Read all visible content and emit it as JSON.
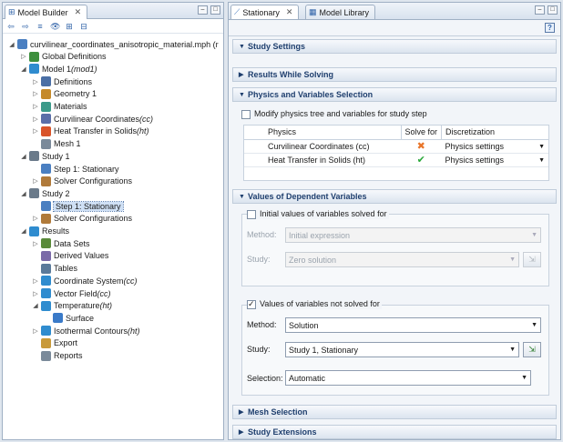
{
  "left_panel": {
    "tab_label": "Model Builder",
    "tree": [
      {
        "label": "curvilinear_coordinates_anisotropic_material.mph (r",
        "italic": "",
        "level": 0,
        "expander": "open",
        "icon": "model-file-icon",
        "color": "#4a7fc1"
      },
      {
        "label": "Global Definitions",
        "italic": "",
        "level": 1,
        "expander": "closed",
        "icon": "global-definitions-icon",
        "color": "#3d8f3d"
      },
      {
        "label": "Model 1 ",
        "italic": "(mod1)",
        "level": 1,
        "expander": "open",
        "icon": "model-icon",
        "color": "#2f8ccf"
      },
      {
        "label": "Definitions",
        "italic": "",
        "level": 2,
        "expander": "closed",
        "icon": "definitions-icon",
        "color": "#4a6fa5"
      },
      {
        "label": "Geometry 1",
        "italic": "",
        "level": 2,
        "expander": "closed",
        "icon": "geometry-icon",
        "color": "#c58a2a"
      },
      {
        "label": "Materials",
        "italic": "",
        "level": 2,
        "expander": "closed",
        "icon": "materials-icon",
        "color": "#3a9a8a"
      },
      {
        "label": "Curvilinear Coordinates ",
        "italic": "(cc)",
        "level": 2,
        "expander": "closed",
        "icon": "curvilinear-coordinates-icon",
        "color": "#5a6ea8"
      },
      {
        "label": "Heat Transfer in Solids ",
        "italic": "(ht)",
        "level": 2,
        "expander": "closed",
        "icon": "heat-transfer-icon",
        "color": "#d9542a"
      },
      {
        "label": "Mesh 1",
        "italic": "",
        "level": 2,
        "expander": "",
        "icon": "mesh-icon",
        "color": "#7a8a9a"
      },
      {
        "label": "Study 1",
        "italic": "",
        "level": 1,
        "expander": "open",
        "icon": "study-icon",
        "color": "#6a7a8a"
      },
      {
        "label": "Step 1: Stationary",
        "italic": "",
        "level": 2,
        "expander": "",
        "icon": "stationary-step-icon",
        "color": "#4a7fc1"
      },
      {
        "label": "Solver Configurations",
        "italic": "",
        "level": 2,
        "expander": "closed",
        "icon": "solver-configurations-icon",
        "color": "#b07a3a"
      },
      {
        "label": "Study 2",
        "italic": "",
        "level": 1,
        "expander": "open",
        "icon": "study-icon",
        "color": "#6a7a8a"
      },
      {
        "label": "Step 1: Stationary",
        "italic": "",
        "level": 2,
        "expander": "",
        "icon": "stationary-step-icon",
        "color": "#4a7fc1",
        "selected": true
      },
      {
        "label": "Solver Configurations",
        "italic": "",
        "level": 2,
        "expander": "closed",
        "icon": "solver-configurations-icon",
        "color": "#b07a3a"
      },
      {
        "label": "Results",
        "italic": "",
        "level": 1,
        "expander": "open",
        "icon": "results-icon",
        "color": "#2f8ccf"
      },
      {
        "label": "Data Sets",
        "italic": "",
        "level": 2,
        "expander": "closed",
        "icon": "data-sets-icon",
        "color": "#5a8a3a"
      },
      {
        "label": "Derived Values",
        "italic": "",
        "level": 2,
        "expander": "",
        "icon": "derived-values-icon",
        "color": "#7a6aa8"
      },
      {
        "label": "Tables",
        "italic": "",
        "level": 2,
        "expander": "",
        "icon": "tables-icon",
        "color": "#5a7a9a"
      },
      {
        "label": "Coordinate System ",
        "italic": "(cc)",
        "level": 2,
        "expander": "closed",
        "icon": "coordinate-system-icon",
        "color": "#2f8ccf"
      },
      {
        "label": "Vector Field ",
        "italic": "(cc)",
        "level": 2,
        "expander": "closed",
        "icon": "vector-field-icon",
        "color": "#2f8ccf"
      },
      {
        "label": "Temperature ",
        "italic": "(ht)",
        "level": 2,
        "expander": "open",
        "icon": "temperature-icon",
        "color": "#2f8ccf"
      },
      {
        "label": "Surface",
        "italic": "",
        "level": 3,
        "expander": "",
        "icon": "surface-icon",
        "color": "#3a7ac8"
      },
      {
        "label": "Isothermal Contours ",
        "italic": "(ht)",
        "level": 2,
        "expander": "closed",
        "icon": "isothermal-contours-icon",
        "color": "#2f8ccf"
      },
      {
        "label": "Export",
        "italic": "",
        "level": 2,
        "expander": "",
        "icon": "export-icon",
        "color": "#c89a3a"
      },
      {
        "label": "Reports",
        "italic": "",
        "level": 2,
        "expander": "",
        "icon": "reports-icon",
        "color": "#7a8a9a"
      }
    ]
  },
  "right_panel": {
    "tabs": [
      {
        "label": "Stationary",
        "icon": "stationary-step-icon"
      },
      {
        "label": "Model Library",
        "icon": "model-library-icon"
      }
    ],
    "sections": {
      "study_settings": "Study Settings",
      "results_while_solving": "Results While Solving",
      "physics_selection": "Physics and Variables Selection",
      "values_dependent": "Values of Dependent Variables",
      "mesh_selection": "Mesh Selection",
      "study_extensions": "Study Extensions"
    },
    "physics": {
      "modify_label": "Modify physics tree and variables for study step",
      "columns": [
        "Physics",
        "Solve for",
        "Discretization"
      ],
      "rows": [
        {
          "physics": "Curvilinear Coordinates (cc)",
          "solve_for": "✖",
          "solve_color": "#e8752a",
          "discretization": "Physics settings"
        },
        {
          "physics": "Heat Transfer in Solids (ht)",
          "solve_for": "✔",
          "solve_color": "#2aa83a",
          "discretization": "Physics settings"
        }
      ]
    },
    "initial_values": {
      "checkbox_label": "Initial values of variables solved for",
      "method_label": "Method:",
      "method_value": "Initial expression",
      "study_label": "Study:",
      "study_value": "Zero solution"
    },
    "not_solved": {
      "checkbox_label": "Values of variables not solved for",
      "method_label": "Method:",
      "method_value": "Solution",
      "study_label": "Study:",
      "study_value": "Study 1, Stationary",
      "selection_label": "Selection:",
      "selection_value": "Automatic"
    }
  }
}
